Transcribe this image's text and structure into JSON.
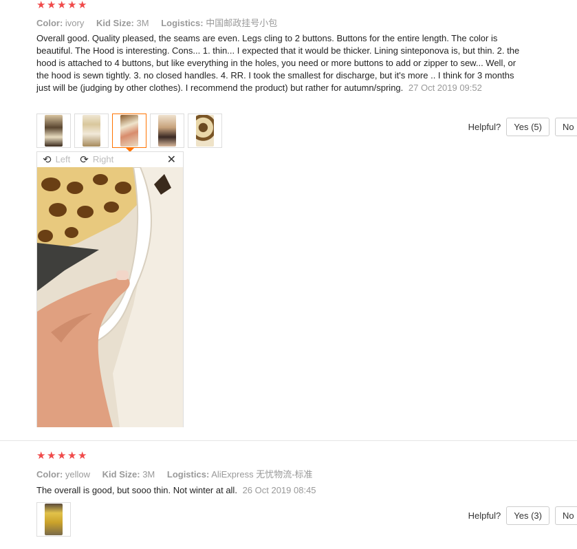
{
  "reviews": [
    {
      "rating": 5,
      "stars": [
        "★",
        "★",
        "★",
        "★",
        "★"
      ],
      "color_label": "Color:",
      "color_value": "ivory",
      "size_label": "Kid Size:",
      "size_value": "3M",
      "logistics_label": "Logistics:",
      "logistics_value": "中国邮政挂号小包",
      "text": "Overall good. Quality pleased, the seams are even. Legs cling to 2 buttons. Buttons for the entire length. The color is beautiful. The Hood is interesting. Cons... 1. thin... I expected that it would be thicker. Lining sinteponova is, but thin. 2. the hood is attached to 4 buttons, but like everything in the holes, you need or more buttons to add or zipper to sew... Well, or the hood is sewn tightly. 3. no closed handles. 4. RR. I took the smallest for discharge, but it's more .. I think for 3 months just will be (judging by other clothes). I recommend the product) but rather for autumn/spring.",
      "date": "27 Oct 2019 09:52",
      "thumbnails": 5,
      "helpful_label": "Helpful?",
      "yes_label": "Yes (5)",
      "no_label": "No"
    },
    {
      "rating": 5,
      "stars": [
        "★",
        "★",
        "★",
        "★",
        "★"
      ],
      "color_label": "Color:",
      "color_value": "yellow",
      "size_label": "Kid Size:",
      "size_value": "3M",
      "logistics_label": "Logistics:",
      "logistics_value": "AliExpress 无忧物流-标准",
      "text": "The overall is good, but sooo thin. Not winter at all.",
      "date": "26 Oct 2019 08:45",
      "thumbnails": 1,
      "helpful_label": "Helpful?",
      "yes_label": "Yes (3)",
      "no_label": "No"
    }
  ],
  "viewer": {
    "rotate_left_icon": "rotate-left-icon",
    "rotate_left_label": "Left",
    "rotate_right_icon": "rotate-right-icon",
    "rotate_right_label": "Right",
    "close_glyph": "✕"
  },
  "colors": {
    "star": "#f04a4a",
    "active_border": "#ff7300",
    "muted_text": "#999999"
  }
}
